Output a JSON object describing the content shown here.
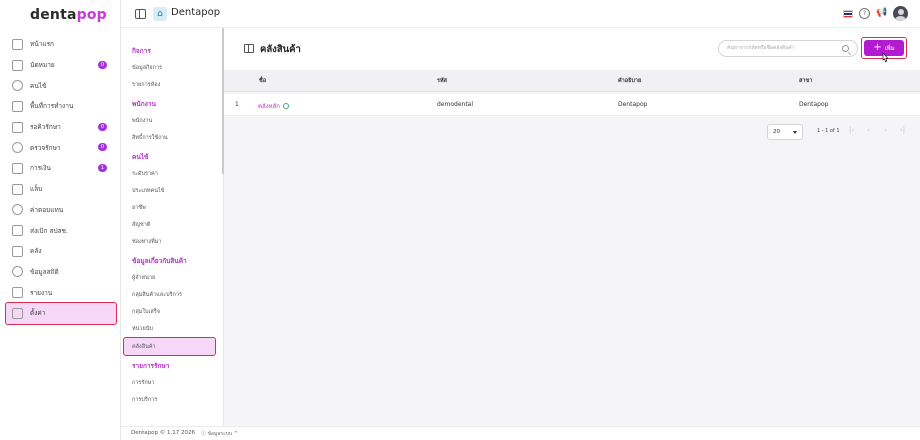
{
  "app": {
    "logo_main": "denta",
    "logo_accent": "pop",
    "brand_letter": "⌂",
    "brand_name": "Dentapop"
  },
  "sidebar": {
    "items": [
      {
        "label": "หน้าแรก",
        "icon": "home-icon"
      },
      {
        "label": "นัดหมาย",
        "icon": "calendar-icon",
        "badge": "0"
      },
      {
        "label": "คนไข้",
        "icon": "patient-icon"
      },
      {
        "label": "พื้นที่การทำงาน",
        "icon": "workspace-icon"
      },
      {
        "label": "รอคิวรักษา",
        "icon": "queue-icon",
        "badge": "0"
      },
      {
        "label": "ตรวจรักษา",
        "icon": "treatment-icon",
        "badge": "0"
      },
      {
        "label": "การเงิน",
        "icon": "finance-icon",
        "badge": "1"
      },
      {
        "label": "แล็บ",
        "icon": "lab-icon"
      },
      {
        "label": "ค่าตอบแทน",
        "icon": "percent-icon"
      },
      {
        "label": "ส่งเบิก สปสช.",
        "icon": "claim-icon"
      },
      {
        "label": "คลัง",
        "icon": "warehouse-icon"
      },
      {
        "label": "ข้อมูลสถิติ",
        "icon": "stats-icon"
      },
      {
        "label": "รายงาน",
        "icon": "report-icon"
      },
      {
        "label": "ตั้งค่า",
        "icon": "gear-icon",
        "active": true
      }
    ]
  },
  "subnav": {
    "sections": [
      {
        "title": "กิจการ",
        "items": [
          "ข้อมูลกิจการ",
          "รายการห้อง"
        ]
      },
      {
        "title": "พนักงาน",
        "items": [
          "พนักงาน",
          "สิทธิ์การใช้งาน"
        ]
      },
      {
        "title": "คนไข้",
        "items": [
          "ระดับราคา",
          "ประเภทคนไข้",
          "อาชีพ",
          "สัญชาติ",
          "ช่องทางที่มา"
        ]
      },
      {
        "title": "ข้อมูลเกี่ยวกับสินค้า",
        "items": [
          "ผู้จำหน่าย",
          "กลุ่มสินค้าและบริการ",
          "กลุ่มใบเสร็จ",
          "หน่วยนับ",
          "คลังสินค้า"
        ]
      },
      {
        "title": "รายการรักษา",
        "items": [
          "การรักษา",
          "การบริการ"
        ]
      }
    ],
    "active_item": "คลังสินค้า"
  },
  "page": {
    "title": "คลังสินค้า",
    "search_placeholder": "ค้นหาจากรหัสหรือชื่อคลังสินค้า",
    "add_label": "เพิ่ม"
  },
  "table": {
    "columns": [
      "ชื่อ",
      "รหัส",
      "คำอธิบาย",
      "สาขา"
    ],
    "rows": [
      {
        "index": "1",
        "name": "คลังหลัก",
        "code": "demodental",
        "description": "Dentapop",
        "branch": "Dentapop"
      }
    ]
  },
  "pagination": {
    "page_size": "20",
    "range": "1 - 1 of 1",
    "nav": [
      "|‹",
      "‹",
      "›",
      "›|"
    ]
  },
  "footer": {
    "copyright": "Dentapop © 1.17 2026",
    "system_info": "ⓘ ข้อมูลระบบ ^"
  },
  "colors": {
    "accent": "#b31bd1",
    "highlight": "#f6d7f7",
    "outline": "#d62f4f",
    "link": "#b534c9"
  }
}
